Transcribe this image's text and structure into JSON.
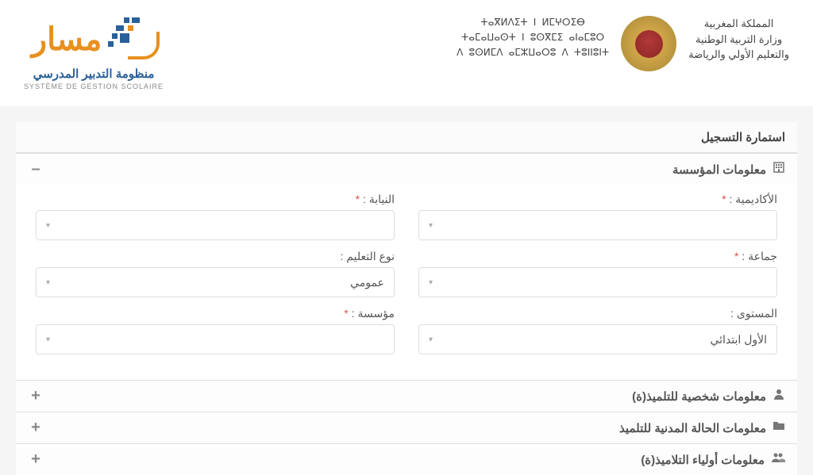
{
  "header": {
    "ministry_line1": "المملكة المغربية",
    "ministry_line2": "وزارة التربية الوطنية",
    "ministry_line3": "والتعليم الأولي والرياضة",
    "tamazight_line1": "ⵜⴰⴳⵍⴷⵉⵜ ⵏ ⵍⵎⵖⵔⵉⴱ",
    "tamazight_line2": "ⵜⴰⵎⴰⵡⴰⵙⵜ ⵏ ⵓⵙⴳⵎⵉ ⴰⵏⴰⵎⵓⵔ",
    "tamazight_line3": "ⴷ ⵓⵙⵍⵎⴷ ⴰⵎⵣⵡⴰⵔⵓ ⴷ ⵜⵓⵏⵏⵓⵏⵜ",
    "logo_ar": "مسار",
    "logo_sub_ar": "منظومة التدبير المدرسي",
    "logo_sub_fr": "SYSTÈME DE GESTION SCOLAIRE"
  },
  "form": {
    "title": "استمارة التسجيل",
    "sections": {
      "institution": {
        "title": "معلومات المؤسسة",
        "toggle": "–",
        "fields": {
          "academy_label": "الأكاديمية :",
          "academy_value": "",
          "delegation_label": "النيابة :",
          "delegation_value": "",
          "commune_label": "جماعة :",
          "commune_value": "",
          "education_type_label": "نوع التعليم :",
          "education_type_value": "عمومي",
          "level_label": "المستوى :",
          "level_value": "الأول ابتدائي",
          "school_label": "مؤسسة :",
          "school_value": ""
        }
      },
      "personal": {
        "title": "معلومات شخصية للتلميذ(ة)",
        "toggle": "+"
      },
      "civil": {
        "title": "معلومات الحالة المدنية للتلميذ",
        "toggle": "+"
      },
      "guardians": {
        "title": "معلومات أولياء التلاميذ(ة)",
        "toggle": "+"
      }
    }
  }
}
